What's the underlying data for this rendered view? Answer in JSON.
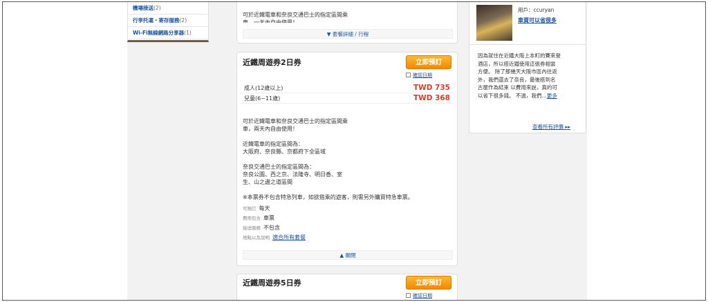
{
  "categories": [
    {
      "label": "機場接送",
      "count": "(2)"
    },
    {
      "label": "行李托運・寄存服務",
      "count": "(2)"
    },
    {
      "label": "Wi-Fi無線網路分享器",
      "count": "(1)"
    }
  ],
  "card_prev": {
    "desc_line1": "可於近鐵電車和奈良交通巴士的指定區間乘",
    "desc_line2": "車，一天內自由使用！",
    "toggle_label": "▼ 套餐詳細 / 行程"
  },
  "card_main": {
    "title": "近鐵周遊券2日券",
    "book_label": "立即預訂",
    "confirm_date": "確認日期",
    "prices": [
      {
        "label": "成人(12歲以上)",
        "value": "TWD 735"
      },
      {
        "label": "兒童(6~11歲)",
        "value": "TWD 368"
      }
    ],
    "desc": [
      "可於近鐵電車和奈良交通巴士的指定區間乘",
      "車，兩天內自由使用！",
      "",
      "近鐵電車的指定區間為：",
      "大阪府、奈良縣、京都府下全區域",
      "",
      "奈良交通巴士的指定區間為：",
      "奈良公園、西之京、法隆寺、明日香、室",
      "生、山之邊之道區間",
      "",
      "※本票券不包含特急列車，如欲搭乘的遊客，則需另外購買特急車票。"
    ],
    "info": [
      {
        "key": "可預訂",
        "value": "每天"
      },
      {
        "key": "費用包含",
        "value": "車票"
      },
      {
        "key": "接送服務",
        "value": "不包含"
      },
      {
        "key": "地點以及說明",
        "value": "適合所有套餐"
      }
    ],
    "toggle_label": "▲ 關閉"
  },
  "card_next": {
    "title": "近鐵周遊券5日券",
    "book_label": "立即預訂",
    "confirm_date": "確認日期"
  },
  "review": {
    "user_label": "用戶",
    "user_name": "ccuryan",
    "link_text": "車資可以省很多",
    "body_lines": [
      "因為就住在近鐵大阪上本町的賽來登",
      "酒店，所以搭近鐵使用這張券相當",
      "方便。 除了那幾天大阪市區內往返",
      "外，我們還去了奈良，最後搭到名",
      "古屋作為結束 以費用來說，真的可",
      "以省下很多錢。 不過，我們"
    ],
    "more_label": "更多",
    "all_reviews": "查看所有評價 ▸▸"
  }
}
